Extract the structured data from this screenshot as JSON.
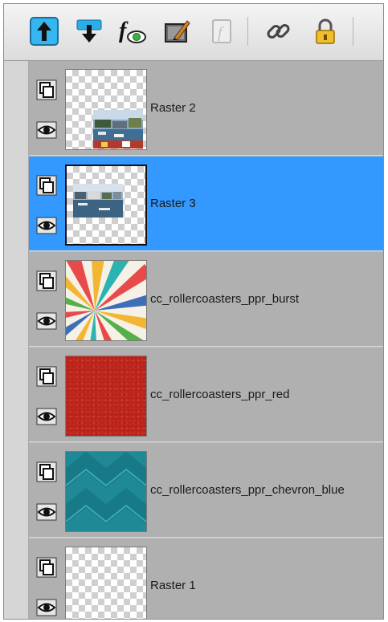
{
  "toolbar": {
    "buttons": [
      {
        "icon": "move-layer-up-icon",
        "active": true
      },
      {
        "icon": "move-layer-down-icon",
        "active": false
      },
      {
        "icon": "layer-effects-icon",
        "active": false
      },
      {
        "icon": "edit-layer-icon",
        "active": false
      },
      {
        "icon": "script-icon",
        "active": false,
        "disabled": true
      },
      {
        "icon": "link-icon",
        "active": false
      },
      {
        "icon": "lock-icon",
        "active": false
      }
    ]
  },
  "layers": [
    {
      "name": "Raster 2",
      "selected": false,
      "thumbnail": "photo-bottom-right"
    },
    {
      "name": "Raster 3",
      "selected": true,
      "thumbnail": "photo-left"
    },
    {
      "name": "cc_rollercoasters_ppr_burst",
      "selected": false,
      "thumbnail": "sunburst"
    },
    {
      "name": "cc_rollercoasters_ppr_red",
      "selected": false,
      "thumbnail": "red-texture"
    },
    {
      "name": "cc_rollercoasters_ppr_chevron_blue",
      "selected": false,
      "thumbnail": "blue-chevron"
    },
    {
      "name": "Raster 1",
      "selected": false,
      "thumbnail": "transparent"
    }
  ],
  "colors": {
    "selected": "#3399ff",
    "layer_bg": "#b0b0b0",
    "red_paper": "#c0281f",
    "blue_paper": "#1f8a96"
  }
}
